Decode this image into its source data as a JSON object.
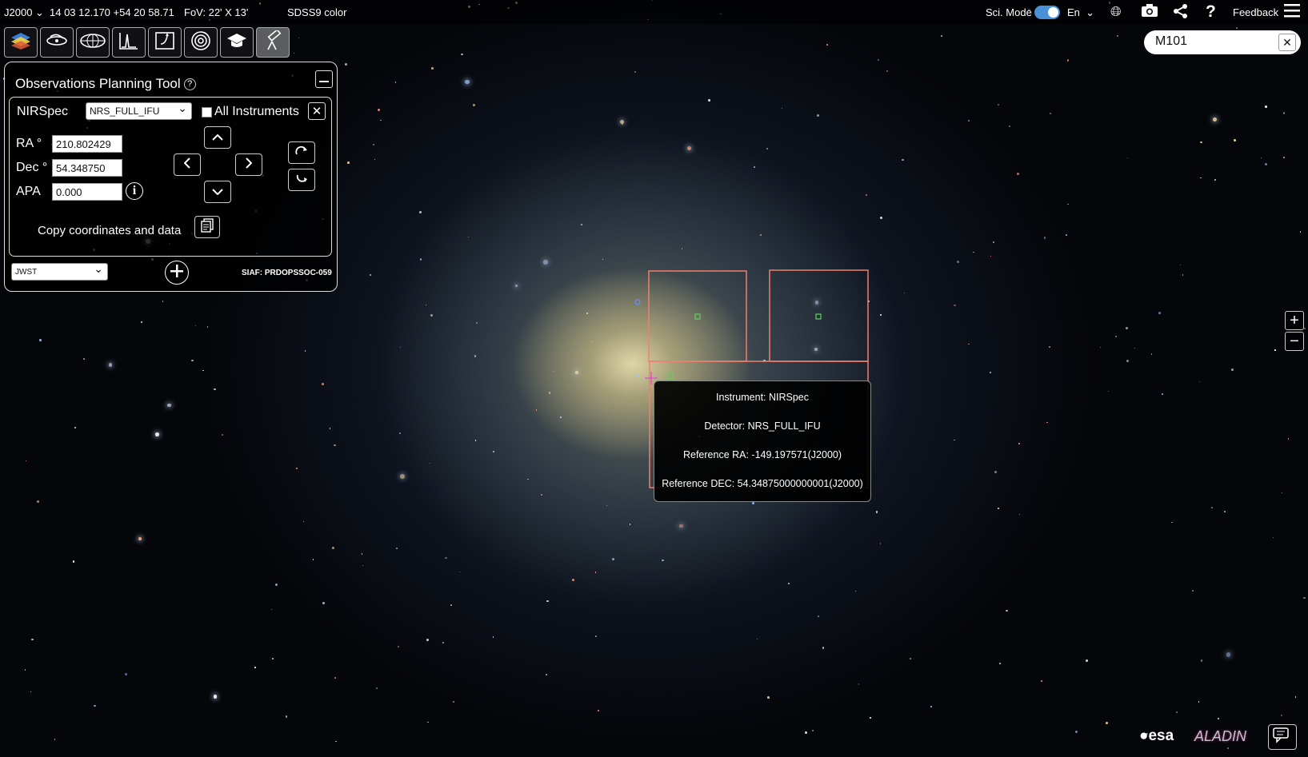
{
  "topbar": {
    "frame": "J2000",
    "coords": "14 03 12.170 +54 20 58.71",
    "fov": "FoV: 22' X 13'",
    "survey": "SDSS9 color",
    "sci_mode_label": "Sci. Mode",
    "sci_mode_on": true,
    "language": "En",
    "feedback_label": "Feedback"
  },
  "toolbar": {
    "buttons": [
      "layers-icon",
      "galaxy-icon",
      "catalog-icon",
      "spectra-icon",
      "footprint-icon",
      "target-icon",
      "education-icon",
      "telescope-icon"
    ],
    "active": "telescope-icon"
  },
  "panel": {
    "title": "Observations Planning Tool",
    "instrument": "NIRSpec",
    "detector": "NRS_FULL_IFU",
    "all_instruments_label": "All Instruments",
    "all_instruments_checked": false,
    "ra_label": "RA °",
    "ra_value": "210.802429",
    "dec_label": "Dec °",
    "dec_value": "54.348750",
    "apa_label": "APA",
    "apa_value": "0.000",
    "copy_label": "Copy coordinates and data",
    "mission": "JWST",
    "siaf": "SIAF: PRDOPSSOC-059"
  },
  "tooltip": {
    "instrument": "Instrument: NIRSpec",
    "detector": "Detector: NRS_FULL_IFU",
    "ref_ra": "Reference RA: -149.197571(J2000)",
    "ref_dec": "Reference DEC: 54.34875000000001(J2000)"
  },
  "search": {
    "value": "M101"
  },
  "branding": {
    "esa": "esa",
    "aladin": "ALADIN"
  },
  "colors": {
    "footprint": "#f08070",
    "toggle": "#4a90d9",
    "marker_green": "#5fd35f"
  }
}
